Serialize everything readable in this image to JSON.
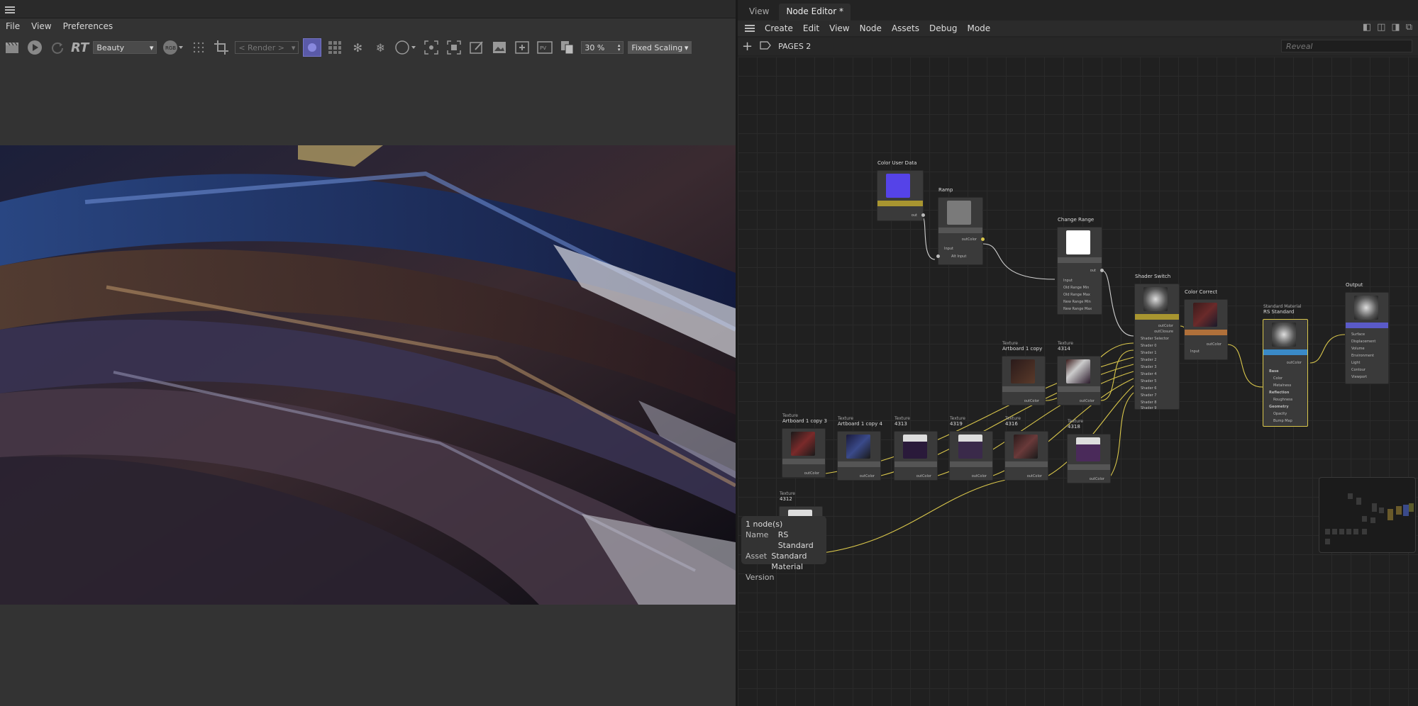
{
  "left_panel": {
    "menu": [
      "File",
      "View",
      "Preferences"
    ],
    "toolbar": {
      "rt_label": "RT",
      "pass_select": "Beauty",
      "rgb_label": "RGB",
      "render_select": "< Render >",
      "zoom_value": "30 %",
      "scaling_select": "Fixed Scaling"
    }
  },
  "node_editor": {
    "tabs": [
      "View",
      "Node Editor *"
    ],
    "active_tab": "Node Editor *",
    "menu": [
      "Create",
      "Edit",
      "View",
      "Node",
      "Assets",
      "Debug",
      "Mode"
    ],
    "path": "PAGES 2",
    "search_placeholder": "Reveal",
    "nodes": {
      "color_user_data": {
        "title": "Color User Data",
        "port_out": "out"
      },
      "ramp": {
        "title": "Ramp",
        "port_out": "outColor",
        "group": "Input",
        "alt_input": "Alt Input"
      },
      "change_range": {
        "title": "Change Range",
        "port_out": "out",
        "ports_in": [
          "Input",
          "Old Range Min",
          "Old Range Max",
          "New Range Min",
          "New Range Max"
        ]
      },
      "shader_switch": {
        "title": "Shader Switch",
        "ports_out": [
          "outColor",
          "outClosure"
        ],
        "ports_in": [
          "Shader Selector",
          "Shader 0",
          "Shader 1",
          "Shader 2",
          "Shader 3",
          "Shader 4",
          "Shader 5",
          "Shader 6",
          "Shader 7",
          "Shader 8",
          "Shader 9"
        ]
      },
      "color_correct": {
        "title": "Color Correct",
        "port_in": "Input",
        "port_out": "outColor"
      },
      "rs_standard": {
        "type": "Standard Material",
        "title": "RS Standard",
        "port_out": "outColor",
        "ports_in": [
          "Base",
          "Color",
          "Metalness",
          "Reflection",
          "Roughness",
          "Geometry",
          "Opacity",
          "Bump Map"
        ]
      },
      "output": {
        "title": "Output",
        "ports_in": [
          "Surface",
          "Displacement",
          "Volume",
          "Environment",
          "Light",
          "Contour",
          "Viewport"
        ]
      }
    },
    "texture_nodes": [
      {
        "type": "Texture",
        "title": "Artboard 1 copy",
        "port_out": "outColor"
      },
      {
        "type": "Texture",
        "title": "4314",
        "port_out": "outColor"
      },
      {
        "type": "Texture",
        "title": "Artboard 1 copy 3",
        "port_out": "outColor"
      },
      {
        "type": "Texture",
        "title": "Artboard 1 copy 4",
        "port_out": "outColor"
      },
      {
        "type": "Texture",
        "title": "4313",
        "port_out": "outColor"
      },
      {
        "type": "Texture",
        "title": "4319",
        "port_out": "outColor"
      },
      {
        "type": "Texture",
        "title": "4316",
        "port_out": "outColor"
      },
      {
        "type": "Texture",
        "title": "4318",
        "port_out": "outColor"
      },
      {
        "type": "Texture",
        "title": "4312",
        "port_out": "outColor"
      }
    ],
    "info": {
      "count": "1 node(s)",
      "name_key": "Name",
      "name_val": "RS Standard",
      "asset_key": "Asset",
      "asset_val": "Standard Material",
      "version_key": "Version"
    }
  },
  "colors": {
    "accent": "#5a5aa8",
    "wire": "#d9c64b",
    "selected_border": "#d9c64b"
  }
}
